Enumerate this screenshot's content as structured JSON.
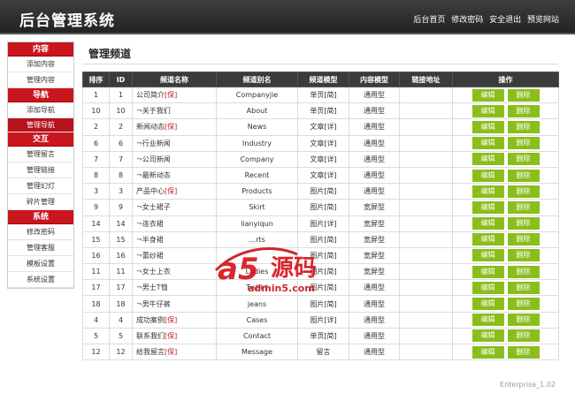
{
  "header": {
    "title": "后台管理系统",
    "links": [
      "后台首页",
      "修改密码",
      "安全退出",
      "预览网站"
    ]
  },
  "sidebar": {
    "groups": [
      {
        "title": "内容",
        "items": [
          "添加内容",
          "管理内容"
        ]
      },
      {
        "title": "导航",
        "items": [
          "添加导航",
          "管理导航"
        ]
      },
      {
        "title": "交互",
        "items": [
          "管理留言",
          "管理链接",
          "管理幻灯",
          "碎片管理"
        ]
      },
      {
        "title": "系统",
        "items": [
          "修改密码",
          "管理客服",
          "模板设置",
          "系统设置"
        ]
      }
    ]
  },
  "main": {
    "title": "管理频道",
    "columns": [
      "排序",
      "ID",
      "频道名称",
      "频道别名",
      "频道模型",
      "内容模型",
      "链接地址",
      "操作"
    ],
    "edit_label": "编辑",
    "delete_label": "删除",
    "rows": [
      {
        "sort": "1",
        "id": "1",
        "name": "公司简介",
        "tag": "[保]",
        "alias": "Companyjie",
        "model": "单页[简]",
        "content": "通用型",
        "link": ""
      },
      {
        "sort": "10",
        "id": "10",
        "name": "¬关于我们",
        "tag": "",
        "alias": "About",
        "model": "单页[简]",
        "content": "通用型",
        "link": ""
      },
      {
        "sort": "2",
        "id": "2",
        "name": "新闻动态",
        "tag": "[保]",
        "alias": "News",
        "model": "文章[详]",
        "content": "通用型",
        "link": ""
      },
      {
        "sort": "6",
        "id": "6",
        "name": "¬行业新闻",
        "tag": "",
        "alias": "Industry",
        "model": "文章[详]",
        "content": "通用型",
        "link": ""
      },
      {
        "sort": "7",
        "id": "7",
        "name": "¬公司新闻",
        "tag": "",
        "alias": "Company",
        "model": "文章[详]",
        "content": "通用型",
        "link": ""
      },
      {
        "sort": "8",
        "id": "8",
        "name": "¬最新动态",
        "tag": "",
        "alias": "Recent",
        "model": "文章[详]",
        "content": "通用型",
        "link": ""
      },
      {
        "sort": "3",
        "id": "3",
        "name": "产品中心",
        "tag": "[保]",
        "alias": "Products",
        "model": "图片[简]",
        "content": "通用型",
        "link": ""
      },
      {
        "sort": "9",
        "id": "9",
        "name": "¬女士裙子",
        "tag": "",
        "alias": "Skirt",
        "model": "图片[简]",
        "content": "宽屏型",
        "link": ""
      },
      {
        "sort": "14",
        "id": "14",
        "name": "¬连衣裙",
        "tag": "",
        "alias": "lianyiqun",
        "model": "图片[详]",
        "content": "宽屏型",
        "link": ""
      },
      {
        "sort": "15",
        "id": "15",
        "name": "¬半身裙",
        "tag": "",
        "alias": "…rts",
        "model": "图片[简]",
        "content": "宽屏型",
        "link": ""
      },
      {
        "sort": "16",
        "id": "16",
        "name": "¬蕾纱裙",
        "tag": "",
        "alias": "",
        "model": "图片[简]",
        "content": "宽屏型",
        "link": ""
      },
      {
        "sort": "11",
        "id": "11",
        "name": "¬女士上衣",
        "tag": "",
        "alias": "Ladies",
        "model": "图片[简]",
        "content": "宽屏型",
        "link": ""
      },
      {
        "sort": "17",
        "id": "17",
        "name": "¬男士T恤",
        "tag": "",
        "alias": "T-shirt",
        "model": "图片[简]",
        "content": "通用型",
        "link": ""
      },
      {
        "sort": "18",
        "id": "18",
        "name": "¬男牛仔裤",
        "tag": "",
        "alias": "jeans",
        "model": "图片[简]",
        "content": "通用型",
        "link": ""
      },
      {
        "sort": "4",
        "id": "4",
        "name": "成功案例",
        "tag": "[保]",
        "alias": "Cases",
        "model": "图片[详]",
        "content": "通用型",
        "link": ""
      },
      {
        "sort": "5",
        "id": "5",
        "name": "联系我们",
        "tag": "[保]",
        "alias": "Contact",
        "model": "单页[简]",
        "content": "通用型",
        "link": ""
      },
      {
        "sort": "12",
        "id": "12",
        "name": "给我留言",
        "tag": "[保]",
        "alias": "Message",
        "model": "留言",
        "content": "通用型",
        "link": ""
      }
    ]
  },
  "watermark": {
    "logo": "a5",
    "text": "源码",
    "url": "admin5.com"
  },
  "footer": {
    "version": "Enterprise_1.02"
  },
  "colors": {
    "topbar": "#2f2f2f",
    "accent_red": "#c9161f",
    "button_green": "#8bbd1c",
    "table_header": "#3b3b3b"
  }
}
